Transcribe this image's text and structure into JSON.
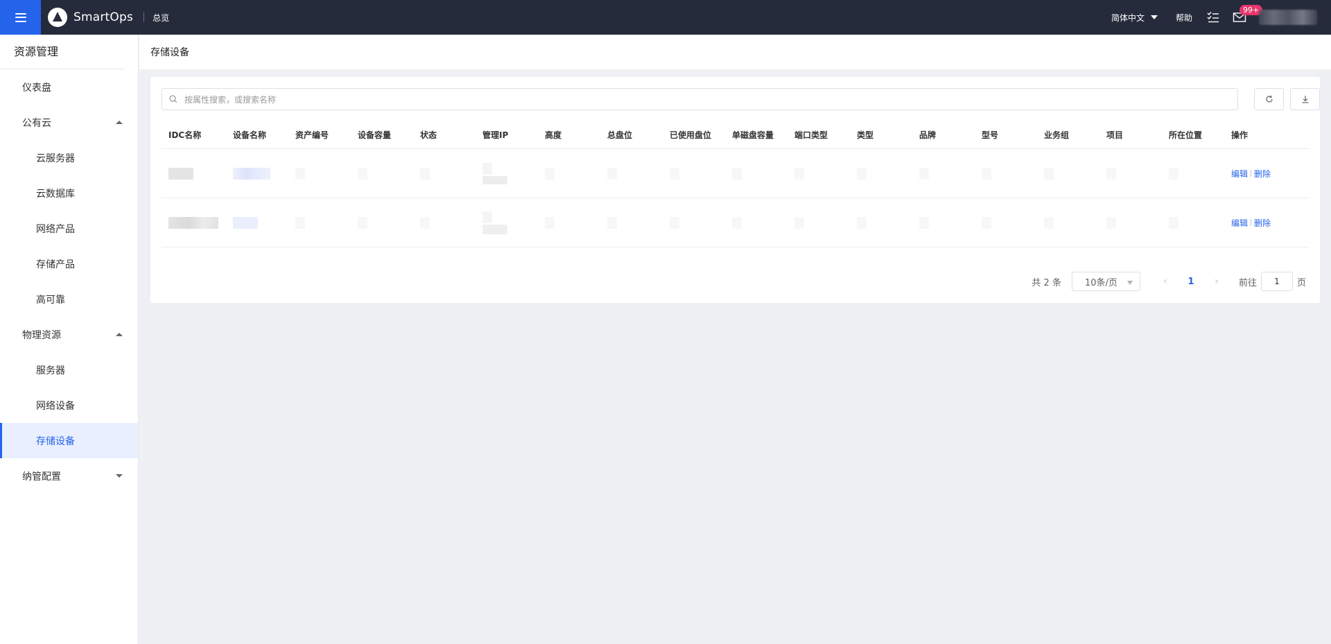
{
  "topbar": {
    "brand": "SmartOps",
    "crumb": "总览",
    "language": "简体中文",
    "help": "帮助",
    "mail_badge": "99+",
    "icons": [
      "menu-icon",
      "logo-icon",
      "todo-list-icon",
      "mail-icon"
    ],
    "colors": {
      "bar": "#262b3c",
      "menu_button": "#2563eb",
      "badge": "#e8346a"
    }
  },
  "sidebar": {
    "title": "资源管理",
    "items": [
      {
        "label": "仪表盘",
        "level": 1
      },
      {
        "label": "公有云",
        "level": 1,
        "expanded": true
      },
      {
        "label": "云服务器",
        "level": 2
      },
      {
        "label": "云数据库",
        "level": 2
      },
      {
        "label": "网络产品",
        "level": 2
      },
      {
        "label": "存储产品",
        "level": 2
      },
      {
        "label": "高可靠",
        "level": 2
      },
      {
        "label": "物理资源",
        "level": 1,
        "expanded": true
      },
      {
        "label": "服务器",
        "level": 2
      },
      {
        "label": "网络设备",
        "level": 2
      },
      {
        "label": "存储设备",
        "level": 2,
        "active": true
      },
      {
        "label": "纳管配置",
        "level": 1,
        "expanded": false
      }
    ]
  },
  "page": {
    "title": "存储设备"
  },
  "search": {
    "placeholder": "按属性搜索，或搜索名称"
  },
  "table": {
    "columns": [
      "IDC名称",
      "设备名称",
      "资产编号",
      "设备容量",
      "状态",
      "管理IP",
      "高度",
      "总盘位",
      "已使用盘位",
      "单磁盘容量",
      "端口类型",
      "类型",
      "品牌",
      "型号",
      "业务组",
      "项目",
      "所在位置",
      "操作"
    ],
    "rows": [
      {
        "actions": {
          "edit": "编辑",
          "delete": "删除"
        }
      },
      {
        "actions": {
          "edit": "编辑",
          "delete": "删除"
        }
      }
    ]
  },
  "pagination": {
    "total": "共 2 条",
    "page_size": "10条/页",
    "current_page": "1",
    "goto_prefix": "前往",
    "goto_value": "1",
    "goto_suffix": "页"
  }
}
